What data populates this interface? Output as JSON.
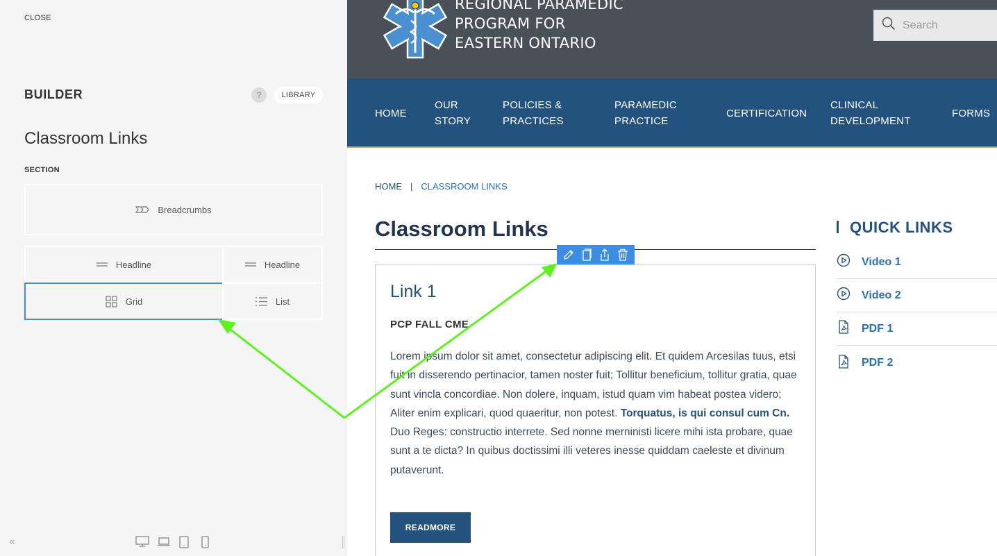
{
  "builder": {
    "close_label": "CLOSE",
    "title": "BUILDER",
    "help_label": "?",
    "library_label": "LIBRARY",
    "page_name": "Classroom Links",
    "section_label": "SECTION",
    "blocks": {
      "breadcrumbs": "Breadcrumbs",
      "headline_1": "Headline",
      "headline_2": "Headline",
      "grid": "Grid",
      "list": "List"
    },
    "collapse_label": "«"
  },
  "site": {
    "org_name_lines": [
      "REGIONAL PARAMEDIC",
      "PROGRAM FOR",
      "EASTERN ONTARIO"
    ],
    "search_placeholder": "Search",
    "nav": [
      "HOME",
      "OUR\nSTORY",
      "POLICIES &\nPRACTICES",
      "PARAMEDIC\nPRACTICE",
      "CERTIFICATION",
      "CLINICAL\nDEVELOPMENT",
      "FORMS"
    ],
    "breadcrumb": {
      "home": "HOME",
      "separator": "|",
      "current": "CLASSROOM LINKS"
    },
    "page_title": "Classroom Links",
    "card": {
      "title": "Link 1",
      "subtitle": "PCP FALL CME",
      "body_start": "Lorem ipsum dolor sit amet, consectetur adipiscing elit. Et quidem Arcesilas tuus, etsi fuit in disserendo pertinacior, tamen noster fuit; Tollitur beneficium, tollitur gratia, quae sunt vincla concordiae. Non dolere, inquam, istud quam vim habeat postea videro; Aliter enim explicari, quod quaeritur, non potest. ",
      "body_bold": "Torquatus, is qui consul cum Cn.",
      "body_end": " Duo Reges: constructio interrete. Sed nonne merninisti licere mihi ista probare, quae sunt a te dicta? In quibus doctissimi illi veteres inesse quiddam caeleste et divinum putaverunt.",
      "button": "READMORE"
    },
    "quick_links": {
      "title": "QUICK LINKS",
      "items": [
        {
          "label": "Video 1",
          "icon": "play-circle-icon"
        },
        {
          "label": "Video 2",
          "icon": "play-circle-icon"
        },
        {
          "label": "PDF 1",
          "icon": "pdf-icon"
        },
        {
          "label": "PDF 2",
          "icon": "pdf-icon"
        }
      ]
    }
  },
  "colors": {
    "header_bg": "#4a5058",
    "nav_bg": "#24527f",
    "accent_blue": "#3d8ee3",
    "arrow_green": "#5df21e"
  }
}
